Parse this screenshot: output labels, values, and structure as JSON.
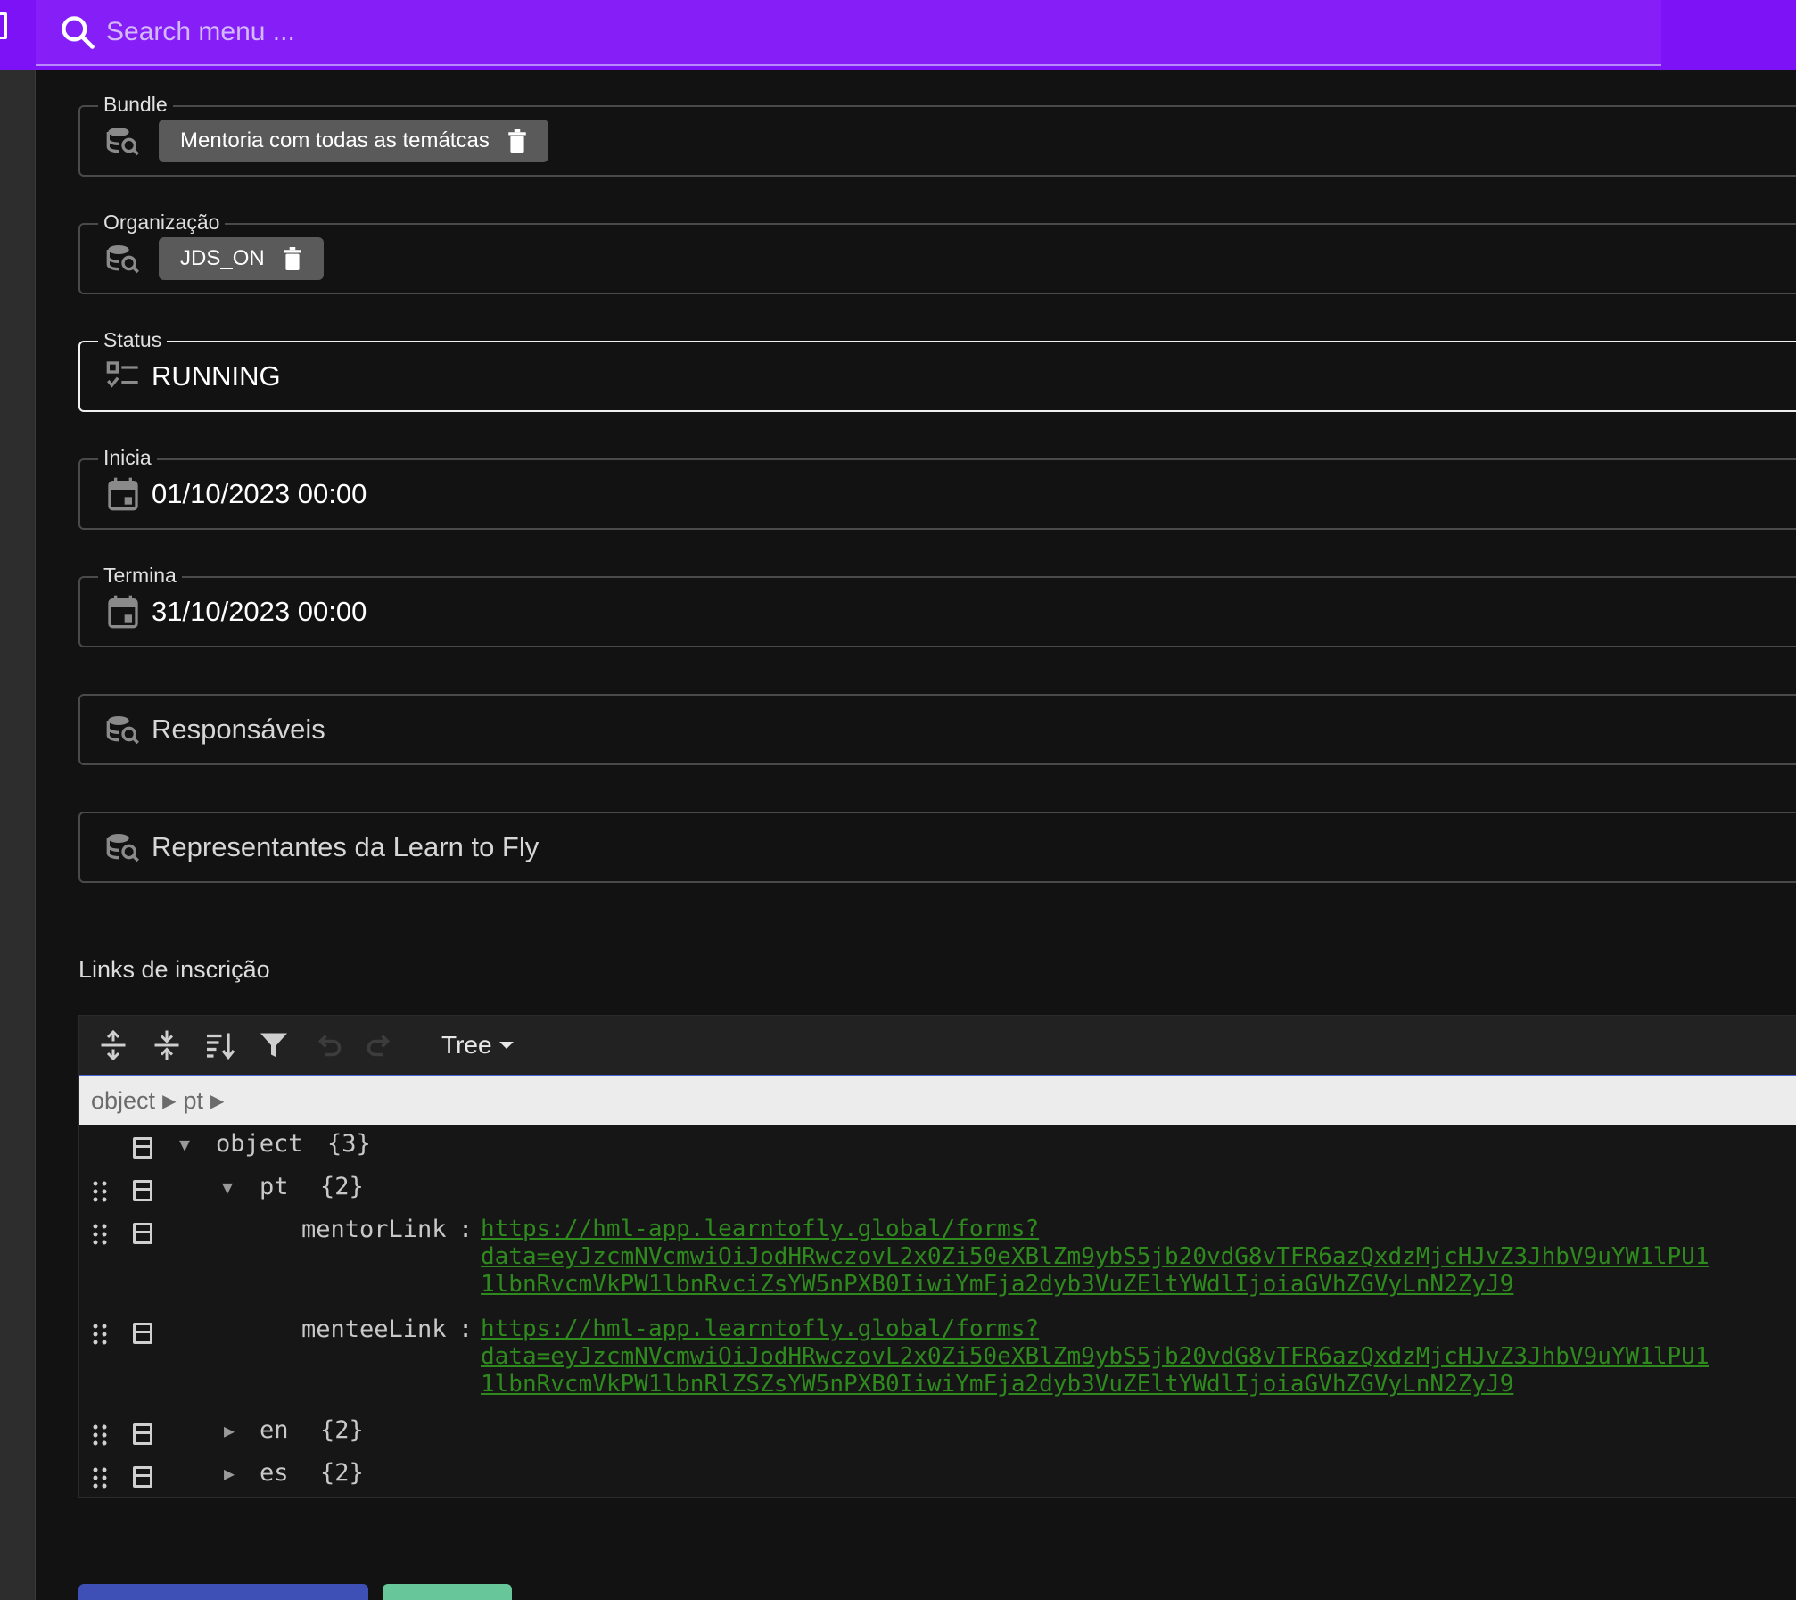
{
  "search": {
    "placeholder": "Search menu ..."
  },
  "form": {
    "bundle": {
      "label": "Bundle",
      "chip": "Mentoria com todas as temátcas"
    },
    "organizacao": {
      "label": "Organização",
      "chip": "JDS_ON"
    },
    "status": {
      "label": "Status",
      "value": "RUNNING"
    },
    "inicia": {
      "label": "Inicia",
      "value": "01/10/2023 00:00"
    },
    "termina": {
      "label": "Termina",
      "value": "31/10/2023 00:00"
    },
    "responsaveis": {
      "placeholder": "Responsáveis"
    },
    "representantes": {
      "placeholder": "Representantes da Learn to Fly"
    }
  },
  "links_section": {
    "label": "Links de inscrição"
  },
  "json_editor": {
    "mode": "Tree",
    "breadcrumb": [
      "object",
      "pt"
    ],
    "nodes": {
      "root": {
        "key": "object",
        "count": "{3}"
      },
      "pt": {
        "key": "pt",
        "count": "{2}"
      },
      "mentorLink": {
        "key": "mentorLink",
        "line1": "https://hml-app.learntofly.global/forms?",
        "line2": "data=eyJzcmNVcmwiOiJodHRwczovL2x0Zi50eXBlZm9ybS5jb20vdG8vTFR6azQxdzMjcHJvZ3JhbV9uYW1lPU1",
        "line3": "1lbnRvcmVkPW1lbnRvciZsYW5nPXB0IiwiYmFja2dyb3VuZEltYWdlIjoiaGVhZGVyLnN2ZyJ9"
      },
      "menteeLink": {
        "key": "menteeLink",
        "line1": "https://hml-app.learntofly.global/forms?",
        "line2": "data=eyJzcmNVcmwiOiJodHRwczovL2x0Zi50eXBlZm9ybS5jb20vdG8vTFR6azQxdzMjcHJvZ3JhbV9uYW1lPU1",
        "line3": "1lbnRvcmVkPW1lbnRlZSZsYW5nPXB0IiwiYmFja2dyb3VuZEltYWdlIjoiaGVhZGVyLnN2ZyJ9"
      },
      "en": {
        "key": "en",
        "count": "{2}"
      },
      "es": {
        "key": "es",
        "count": "{2}"
      }
    }
  },
  "colors": {
    "topbar": "#7c12f5",
    "link": "#2f8a1e",
    "primary_button": "#3e4fb5",
    "success_button": "#68c79a"
  },
  "icons": [
    "search-icon",
    "database-search-icon",
    "trash-icon",
    "checklist-icon",
    "calendar-icon",
    "expand-all-icon",
    "collapse-all-icon",
    "sort-icon",
    "filter-icon",
    "undo-icon",
    "redo-icon",
    "drag-handle-icon",
    "context-menu-icon"
  ]
}
